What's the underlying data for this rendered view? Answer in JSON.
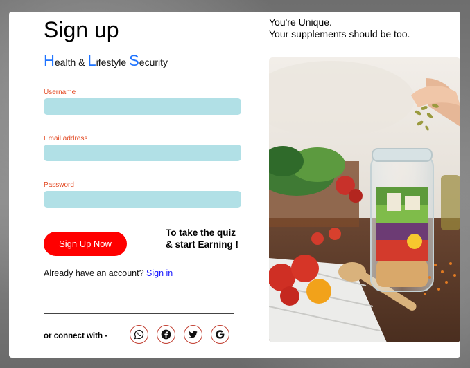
{
  "signup": {
    "title": "Sign up",
    "tagline": [
      {
        "cap": "H",
        "rest": "ealth & "
      },
      {
        "cap": "L",
        "rest": "ifestyle "
      },
      {
        "cap": "S",
        "rest": "ecurity"
      }
    ],
    "fields": {
      "username": {
        "label": "Username",
        "value": ""
      },
      "email": {
        "label": "Email address",
        "value": ""
      },
      "password": {
        "label": "Password",
        "value": ""
      }
    },
    "signup_button": "Sign Up Now",
    "quiz_line1": "To take the quiz",
    "quiz_line2": "& start Earning !",
    "account_text": "Already have an account?",
    "signin_link": "Sign in",
    "connect_text": "or connect with -",
    "social": [
      {
        "name": "whatsapp-icon"
      },
      {
        "name": "facebook-icon"
      },
      {
        "name": "twitter-icon"
      },
      {
        "name": "google-icon"
      }
    ]
  },
  "promo": {
    "line1": "You're Unique.",
    "line2": "Your supplements should be too."
  },
  "colors": {
    "accent": "#ff0000",
    "field_bg": "#b1e0e6",
    "label": "#e2461f",
    "tagline_cap": "#1e73ff"
  }
}
